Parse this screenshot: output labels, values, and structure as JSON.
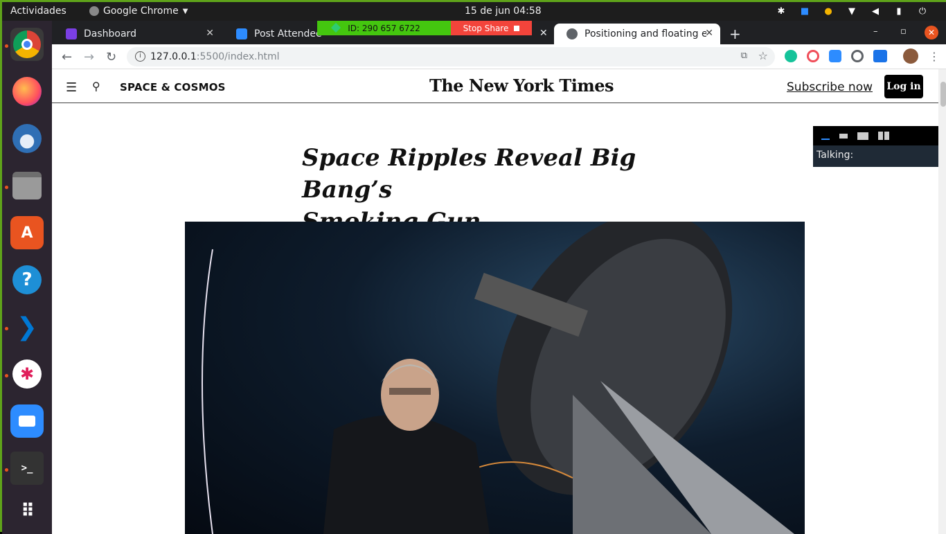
{
  "topbar": {
    "activities": "Actividades",
    "app_name": "Google Chrome",
    "clock": "15 de jun  04:58"
  },
  "tabs": [
    {
      "label": "Dashboard",
      "icon": "dashboard-icon",
      "color": "#7b3fe4"
    },
    {
      "label": "Post Attendee",
      "icon": "zoom-icon",
      "color": "#2d8cff"
    },
    {
      "label": "Positioning and floating e",
      "icon": "globe-icon",
      "color": "#5f6368"
    }
  ],
  "share_bar": {
    "meeting_id": "ID: 290 657 6722",
    "stop_label": "Stop Share"
  },
  "address": {
    "host": "127.0.0.1",
    "path": ":5500/index.html"
  },
  "nyt": {
    "section": "SPACE & COSMOS",
    "logo": "The New York Times",
    "subscribe": "Subscribe now",
    "login": "Log in",
    "headline_line1": "Space Ripples Reveal Big Bang’s",
    "headline_line2": "Smoking Gun"
  },
  "zoom_panel": {
    "talking_label": "Talking:"
  },
  "dock": [
    {
      "name": "chrome",
      "color": "#4285f4",
      "running": true
    },
    {
      "name": "firefox",
      "color": "#ff7139",
      "running": false
    },
    {
      "name": "thunderbird",
      "color": "#2f6fb5",
      "running": false
    },
    {
      "name": "files",
      "color": "#8a8a8a",
      "running": true
    },
    {
      "name": "software",
      "color": "#e95420",
      "running": false
    },
    {
      "name": "help",
      "color": "#1e8fd6",
      "running": false
    },
    {
      "name": "vscode",
      "color": "#0078d4",
      "running": true
    },
    {
      "name": "slack",
      "color": "#ffffff",
      "running": true
    },
    {
      "name": "zoom",
      "color": "#2d8cff",
      "running": false
    },
    {
      "name": "terminal",
      "color": "#333333",
      "running": true
    },
    {
      "name": "app-grid",
      "color": "#2c2530",
      "running": false
    }
  ]
}
